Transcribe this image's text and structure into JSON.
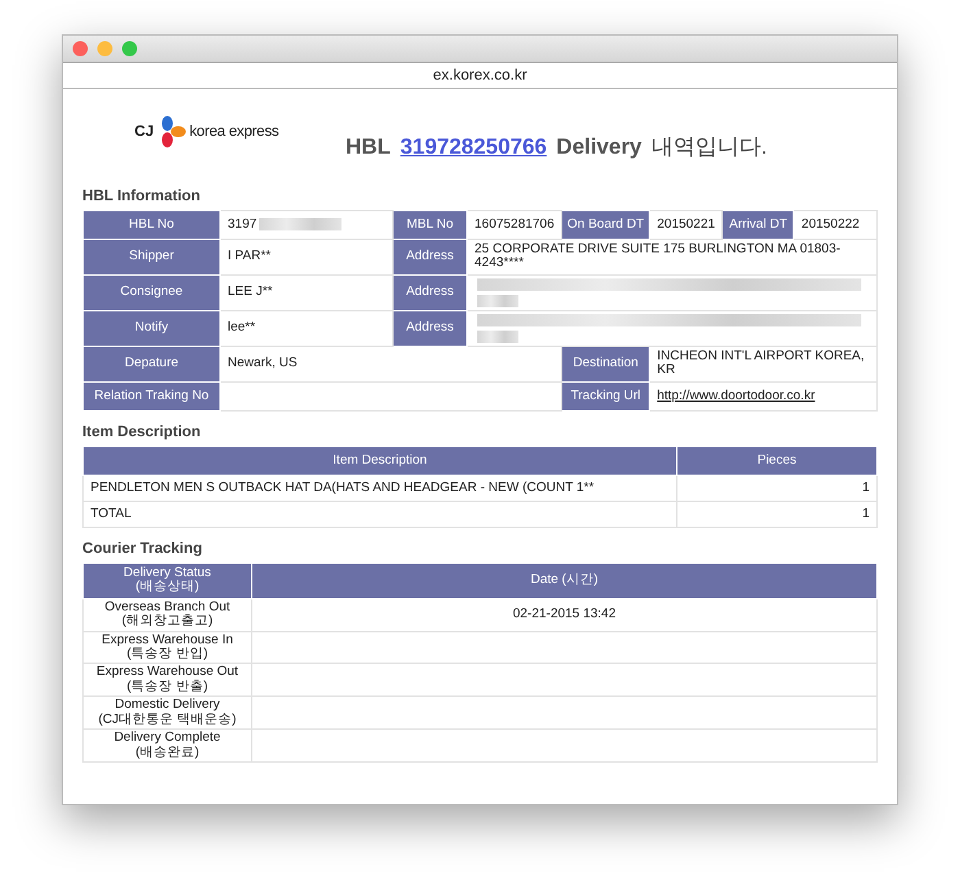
{
  "window": {
    "address": "ex.korex.co.kr"
  },
  "header": {
    "logo_mark": "CJ",
    "logo_text": "korea express",
    "prefix": "HBL",
    "hbl_link": "319728250766",
    "suffix": "Delivery",
    "suffix_ko": "내역입니다."
  },
  "hbl_information": {
    "title": "HBL Information",
    "rows": [
      {
        "kind": "quad",
        "cells": [
          {
            "label": "HBL No",
            "value": "3197",
            "redacted": true
          },
          {
            "label": "MBL No",
            "value": "16075281706"
          },
          {
            "label": "On Board DT",
            "value": "20150221"
          },
          {
            "label": "Arrival DT",
            "value": "20150222"
          }
        ]
      },
      {
        "kind": "wide",
        "cells": [
          {
            "label": "Shipper",
            "value": "I PAR**"
          },
          {
            "label": "Address",
            "value": "25 CORPORATE DRIVE SUITE 175 BURLINGTON MA 01803-4243****"
          }
        ]
      },
      {
        "kind": "wide",
        "cells": [
          {
            "label": "Consignee",
            "value": "LEE J**"
          },
          {
            "label": "Address",
            "redacted": true
          }
        ]
      },
      {
        "kind": "wide",
        "cells": [
          {
            "label": "Notify",
            "value": "lee**"
          },
          {
            "label": "Address",
            "redacted": true
          }
        ]
      },
      {
        "kind": "split",
        "cells": [
          {
            "label": "Depature",
            "value": "Newark, US"
          },
          {
            "label": "Destination",
            "value": "INCHEON INT'L AIRPORT KOREA, KR"
          }
        ]
      },
      {
        "kind": "split",
        "cells": [
          {
            "label": "Relation Traking No"
          },
          {
            "label": "Tracking Url",
            "link": "http://www.doortodoor.co.kr"
          }
        ]
      }
    ]
  },
  "item_description": {
    "title": "Item Description",
    "columns": [
      "Item Description",
      "Pieces"
    ],
    "rows": [
      [
        "PENDLETON MEN S OUTBACK HAT DA(HATS AND HEADGEAR - NEW (COUNT 1**",
        "1"
      ],
      [
        "TOTAL",
        "1"
      ]
    ]
  },
  "courier_tracking": {
    "title": "Courier Tracking",
    "columns": [
      [
        "Delivery Status",
        "(배송상태)"
      ],
      [
        "Date (시간)"
      ]
    ],
    "rows": [
      {
        "status": "Overseas Branch Out",
        "status_ko": "(해외창고출고)",
        "date": "02-21-2015 13:42"
      },
      {
        "status": "Express Warehouse In",
        "status_ko": "(특송장 반입)"
      },
      {
        "status": "Express Warehouse Out",
        "status_ko": "(특송장 반출)"
      },
      {
        "status": "Domestic Delivery",
        "status_ko": "(CJ대한통운 택배운송)"
      },
      {
        "status": "Delivery Complete",
        "status_ko": "(배송완료)"
      }
    ]
  }
}
